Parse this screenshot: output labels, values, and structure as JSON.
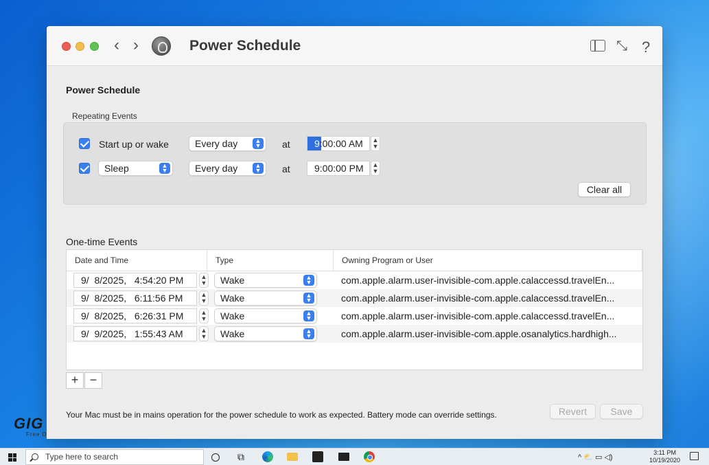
{
  "window": {
    "title": "Power Schedule",
    "nav_back": "‹",
    "nav_forward": "›",
    "help": "?"
  },
  "schedule": {
    "heading": "Power Schedule",
    "repeating": {
      "label": "Repeating Events",
      "rows": [
        {
          "checked": true,
          "event_label": "Start up or wake",
          "frequency": "Every day",
          "at": "at",
          "time_highlight": "9",
          "time_rest": ":00:00 AM"
        },
        {
          "checked": true,
          "event_popup": "Sleep",
          "frequency": "Every day",
          "at": "at",
          "time": "9:00:00 PM"
        }
      ],
      "clear_all": "Clear all"
    },
    "one_time": {
      "label": "One-time Events",
      "columns": [
        "Date and Time",
        "Type",
        "Owning Program or User"
      ],
      "rows": [
        {
          "datetime": "9/  8/2025,   4:54:20 PM",
          "type": "Wake",
          "owner": "com.apple.alarm.user-invisible-com.apple.calaccessd.travelEn..."
        },
        {
          "datetime": "9/  8/2025,   6:11:56 PM",
          "type": "Wake",
          "owner": "com.apple.alarm.user-invisible-com.apple.calaccessd.travelEn..."
        },
        {
          "datetime": "9/  8/2025,   6:26:31 PM",
          "type": "Wake",
          "owner": "com.apple.alarm.user-invisible-com.apple.calaccessd.travelEn..."
        },
        {
          "datetime": "9/  9/2025,   1:55:43 AM",
          "type": "Wake",
          "owner": "com.apple.alarm.user-invisible-com.apple.osanalytics.hardhigh..."
        }
      ],
      "add": "+",
      "remove": "−"
    },
    "footnote": "Your Mac must be in mains operation for the power schedule to work as expected. Battery mode can override settings.",
    "revert": "Revert",
    "save": "Save"
  },
  "watermark": {
    "brand": "GIG",
    "tagline": "Free D"
  },
  "taskbar": {
    "search_placeholder": "Type here to search",
    "time": "3:11 PM",
    "date": "10/19/2020",
    "tray": "^  ⛅  ▭  ◁)"
  }
}
